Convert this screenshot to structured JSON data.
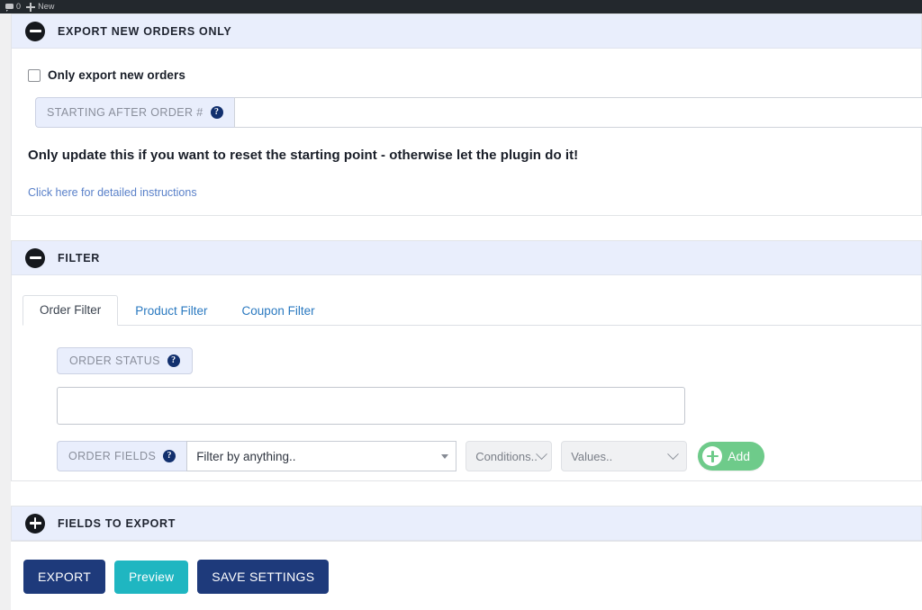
{
  "adminbar": {
    "comment_icon": "comment-bubble-icon",
    "comment_count": "0",
    "new_icon": "plus-icon",
    "new_label": "New"
  },
  "panels": {
    "export_new_orders": {
      "title": "EXPORT NEW ORDERS ONLY",
      "toggle_icon": "minus-circle-icon",
      "toggle_state": "expanded",
      "checkbox": {
        "label": "Only export new orders",
        "checked": false
      },
      "starting_after": {
        "label": "STARTING AFTER ORDER #",
        "help_icon": "question-mark-icon",
        "value": "",
        "placeholder": ""
      },
      "hint": "Only update this if you want to reset the starting point - otherwise let the plugin do it!",
      "link": "Click here for detailed instructions"
    },
    "filter": {
      "title": "FILTER",
      "toggle_icon": "minus-circle-icon",
      "toggle_state": "expanded",
      "tabs": [
        {
          "label": "Order Filter",
          "active": true
        },
        {
          "label": "Product Filter",
          "active": false
        },
        {
          "label": "Coupon Filter",
          "active": false
        }
      ],
      "order_status": {
        "label": "ORDER STATUS",
        "help_icon": "question-mark-icon",
        "value": ""
      },
      "order_fields": {
        "label": "ORDER FIELDS",
        "help_icon": "question-mark-icon",
        "field_select_value": "Filter by anything..",
        "conditions_select_value": "Conditions..",
        "values_select_value": "Values..",
        "add_button_label": "Add",
        "add_button_icon": "plus-circle-icon"
      }
    },
    "fields_to_export": {
      "title": "FIELDS TO EXPORT",
      "toggle_icon": "plus-circle-icon",
      "toggle_state": "collapsed"
    }
  },
  "footer": {
    "export_label": "EXPORT",
    "preview_label": "Preview",
    "save_label": "SAVE SETTINGS"
  },
  "colors": {
    "panel_header": "#e9eefc",
    "accent_blue": "#1e3a7b",
    "accent_teal": "#1fb6c1",
    "accent_green": "#6ecb8a",
    "link_blue": "#5a81c9",
    "adminbar": "#23282d"
  }
}
